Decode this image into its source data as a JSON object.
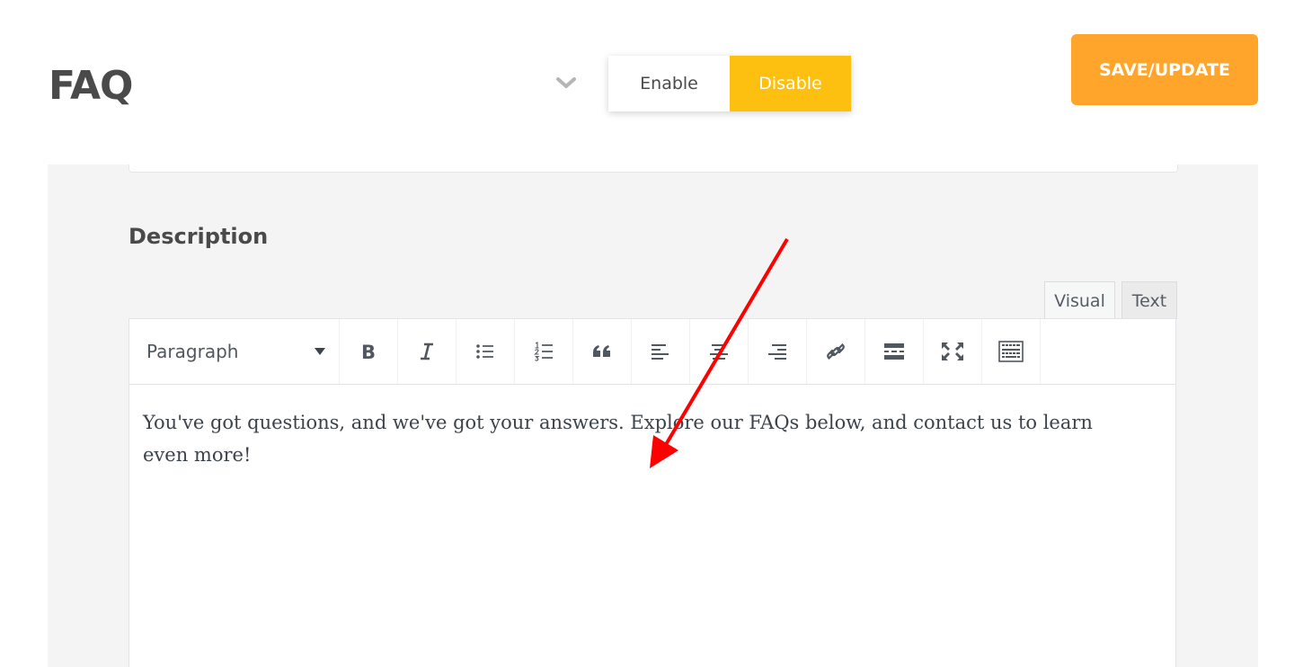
{
  "header": {
    "title": "FAQ",
    "toggle": {
      "enable_label": "Enable",
      "disable_label": "Disable",
      "selected": "Disable"
    },
    "save_label": "SAVE/UPDATE"
  },
  "description": {
    "label": "Description",
    "tabs": {
      "visual": "Visual",
      "text": "Text"
    },
    "toolbar": {
      "format_value": "Paragraph",
      "buttons": [
        "bold-icon",
        "italic-icon",
        "bullet-list-icon",
        "numbered-list-icon",
        "blockquote-icon",
        "align-left-icon",
        "align-center-icon",
        "align-right-icon",
        "link-icon",
        "read-more-icon",
        "fullscreen-icon",
        "toolbar-toggle-icon"
      ]
    },
    "content": "You've got questions, and we've got your answers. Explore our FAQs below, and contact us to learn even more!"
  },
  "colors": {
    "accent_disable": "#fdc010",
    "save_button": "#ffa52b",
    "annotation_arrow": "#ff0000"
  }
}
